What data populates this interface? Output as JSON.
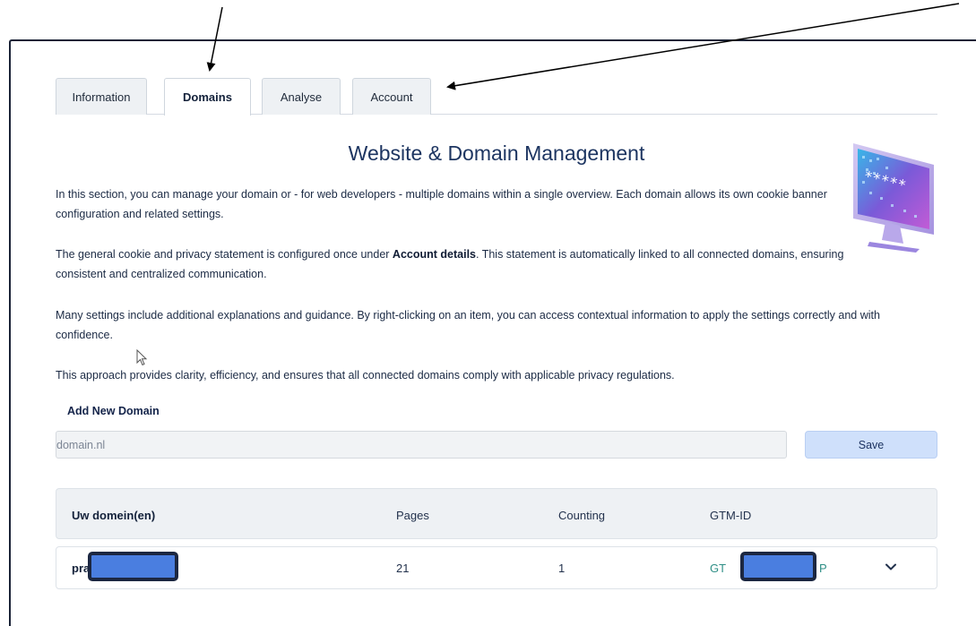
{
  "tabs": [
    {
      "label": "Information",
      "active": false
    },
    {
      "label": "Domains",
      "active": true
    },
    {
      "label": "Analyse",
      "active": false
    },
    {
      "label": "Account",
      "active": false
    }
  ],
  "page": {
    "title": "Website & Domain Management",
    "paragraphs": {
      "p1": "In this section, you can manage your domain or - for web developers - multiple domains within a single overview. Each domain allows its own cookie banner configuration and related settings.",
      "p2_before": "The general cookie and privacy statement is configured once under ",
      "p2_bold": "Account details",
      "p2_after": ". This statement is automatically linked to all connected domains, ensuring consistent and centralized communication.",
      "p3": "Many settings include additional explanations and guidance. By right-clicking on an item, you can access contextual information to apply the settings correctly and with confidence.",
      "p4": "This approach provides clarity, efficiency, and ensures that all connected domains comply with applicable privacy regulations."
    }
  },
  "add_domain": {
    "label": "Add New Domain",
    "placeholder": "domain.nl",
    "save_label": "Save"
  },
  "table": {
    "headers": [
      "Uw domein(en)",
      "Pages",
      "Counting",
      "GTM-ID"
    ],
    "rows": [
      {
        "domain_visible": "pra",
        "pages": "21",
        "counting": "1",
        "gtm_prefix": "GT",
        "gtm_suffix": "P"
      }
    ]
  },
  "colors": {
    "accent": "#1d3561",
    "save_button": "#cfe0fb",
    "gtm_text": "#2f8f86",
    "redaction_fill": "#4a7ee0",
    "redaction_border": "#1c2741"
  },
  "icons": {
    "illustration": "password-monitor-icon",
    "expand": "chevron-down-icon",
    "pointer": "mouse-cursor-icon"
  }
}
